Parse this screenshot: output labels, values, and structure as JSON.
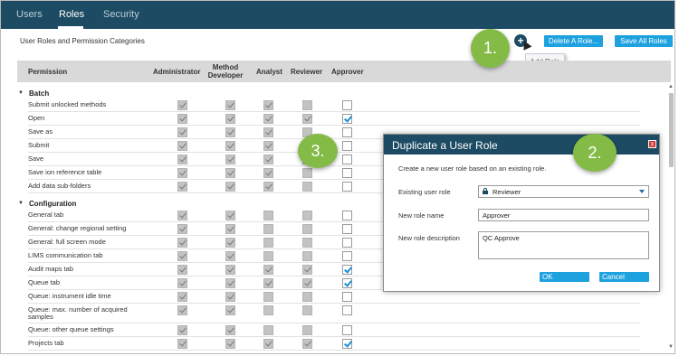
{
  "tabs": [
    {
      "label": "Users"
    },
    {
      "label": "Roles"
    },
    {
      "label": "Security"
    }
  ],
  "page_title": "User Roles and Permission Categories",
  "toolbar": {
    "delete_label": "Delete A Role...",
    "save_all_label": "Save All Roles",
    "add_tooltip": "Add Role"
  },
  "callouts": [
    "1.",
    "2.",
    "3."
  ],
  "columns": {
    "permission": "Permission",
    "administrator": "Administrator",
    "method_developer": "Method Developer",
    "analyst": "Analyst",
    "reviewer": "Reviewer",
    "approver": "Approver"
  },
  "groups": [
    {
      "name": "Batch",
      "rows": [
        {
          "label": "Submit unlocked methods",
          "admin": true,
          "dev": true,
          "analyst": true,
          "reviewer": false,
          "approver": false
        },
        {
          "label": "Open",
          "admin": true,
          "dev": true,
          "analyst": true,
          "reviewer": true,
          "approver": true
        },
        {
          "label": "Save as",
          "admin": true,
          "dev": true,
          "analyst": true,
          "reviewer": false,
          "approver": false
        },
        {
          "label": "Submit",
          "admin": true,
          "dev": true,
          "analyst": true,
          "reviewer": false,
          "approver": false
        },
        {
          "label": "Save",
          "admin": true,
          "dev": true,
          "analyst": true,
          "reviewer": false,
          "approver": false
        },
        {
          "label": "Save ion reference table",
          "admin": true,
          "dev": true,
          "analyst": true,
          "reviewer": false,
          "approver": false
        },
        {
          "label": "Add data sub-folders",
          "admin": true,
          "dev": true,
          "analyst": true,
          "reviewer": false,
          "approver": false
        }
      ]
    },
    {
      "name": "Configuration",
      "rows": [
        {
          "label": "General tab",
          "admin": true,
          "dev": true,
          "analyst": false,
          "reviewer": false,
          "approver": false
        },
        {
          "label": "General: change regional setting",
          "admin": true,
          "dev": true,
          "analyst": false,
          "reviewer": false,
          "approver": false
        },
        {
          "label": "General: full screen mode",
          "admin": true,
          "dev": true,
          "analyst": false,
          "reviewer": false,
          "approver": false
        },
        {
          "label": "LIMS communication tab",
          "admin": true,
          "dev": true,
          "analyst": false,
          "reviewer": false,
          "approver": false
        },
        {
          "label": "Audit maps tab",
          "admin": true,
          "dev": true,
          "analyst": true,
          "reviewer": true,
          "approver": true
        },
        {
          "label": "Queue tab",
          "admin": true,
          "dev": true,
          "analyst": true,
          "reviewer": true,
          "approver": true
        },
        {
          "label": "Queue: instrument idle time",
          "admin": true,
          "dev": true,
          "analyst": false,
          "reviewer": false,
          "approver": false
        },
        {
          "label": "Queue: max. number of acquired samples",
          "admin": true,
          "dev": true,
          "analyst": false,
          "reviewer": false,
          "approver": false
        },
        {
          "label": "Queue: other queue settings",
          "admin": true,
          "dev": true,
          "analyst": false,
          "reviewer": false,
          "approver": false
        },
        {
          "label": "Projects tab",
          "admin": true,
          "dev": true,
          "analyst": true,
          "reviewer": true,
          "approver": true
        }
      ]
    }
  ],
  "dialog": {
    "title": "Duplicate a User Role",
    "close_label": "X",
    "description": "Create a new user role based on an existing role.",
    "existing_role_label": "Existing user role",
    "existing_role_value": "Reviewer",
    "role_name_label": "New role name",
    "role_name_value": "Approver",
    "role_desc_label": "New role description",
    "role_desc_value": "QC Approve",
    "ok_label": "OK",
    "cancel_label": "Cancel"
  },
  "icons": {
    "add": "plus-circle-icon",
    "lock": "lock-icon",
    "dropdown": "chevron-down-icon",
    "check": "checkmark-icon"
  },
  "colors": {
    "topbar": "#1d4b63",
    "accent": "#1da1df",
    "callout": "#84bb47",
    "check_enabled": "#1a8fd6",
    "close": "#c9302c"
  }
}
